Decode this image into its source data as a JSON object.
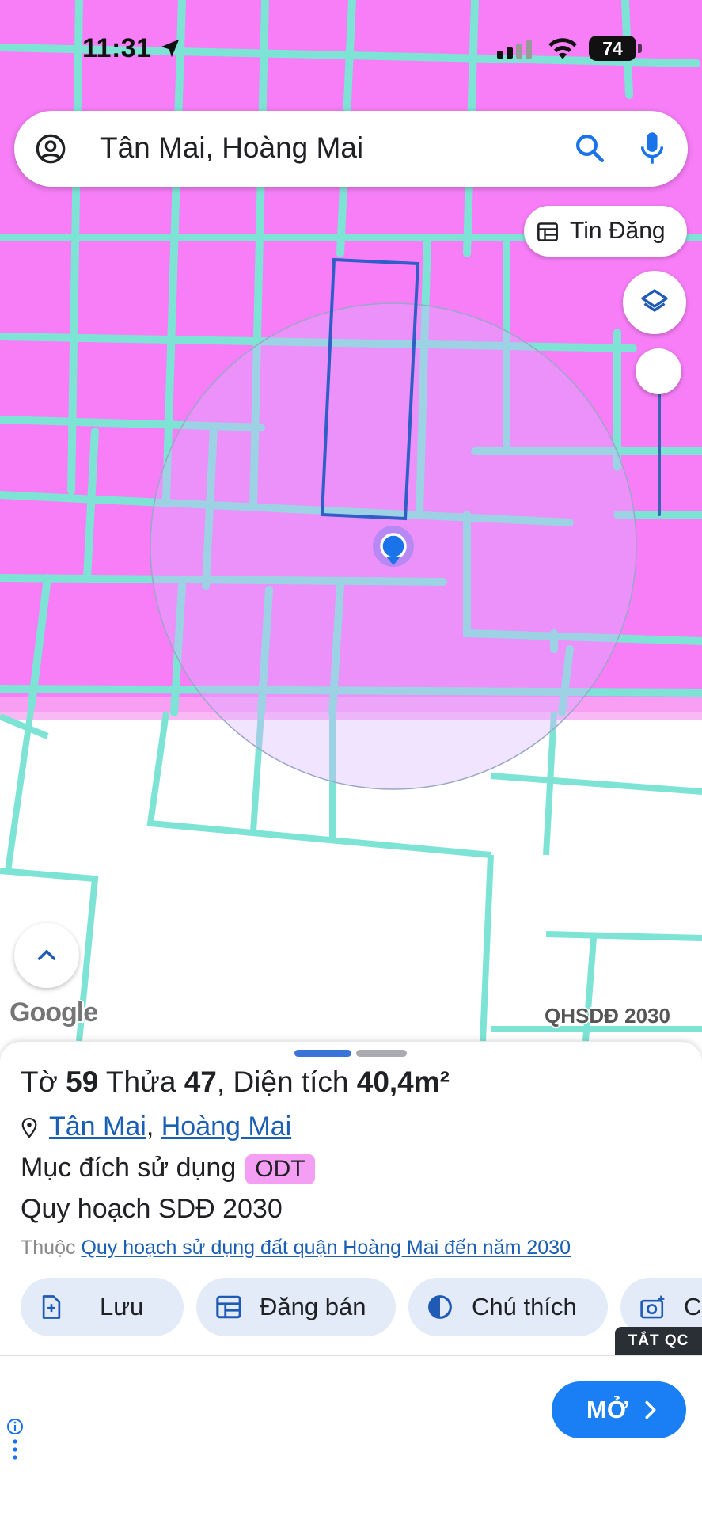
{
  "status": {
    "time": "11:31",
    "battery": "74"
  },
  "search": {
    "query": "Tân Mai, Hoàng Mai"
  },
  "map": {
    "tin_dang_label": "Tin Đăng",
    "google_logo": "Google",
    "plan_label": "QHSDĐ 2030",
    "colors": {
      "residential_zone": "#f77ef7",
      "parcel_lines": "#7de3d4",
      "selected_parcel": "#2f5ec8",
      "location_dot": "#1a73e8"
    }
  },
  "parcel": {
    "title_prefix_to": "Tờ ",
    "to_number": "59",
    "title_thua": " Thửa ",
    "thua_number": "47",
    "title_area_label": ", Diện tích ",
    "area_value": "40,4m²",
    "ward_link": "Tân Mai",
    "separator": ", ",
    "district_link": "Hoàng Mai",
    "purpose_label": "Mục đích sử dụng",
    "purpose_code": "ODT",
    "plan_title": "Quy hoạch SDĐ 2030",
    "belongs_label": "Thuộc ",
    "belongs_link": "Quy hoạch sử dụng đất quận Hoàng Mai đến năm 2030"
  },
  "actions": [
    {
      "label": "Lưu",
      "icon": "add-document-icon"
    },
    {
      "label": "Đăng bán",
      "icon": "calendar-table-icon"
    },
    {
      "label": "Chú thích",
      "icon": "contrast-icon"
    },
    {
      "label": "C",
      "icon": "camera-add-icon"
    }
  ],
  "ad": {
    "close_label": "TẮT QC",
    "open_label": "MỞ"
  }
}
